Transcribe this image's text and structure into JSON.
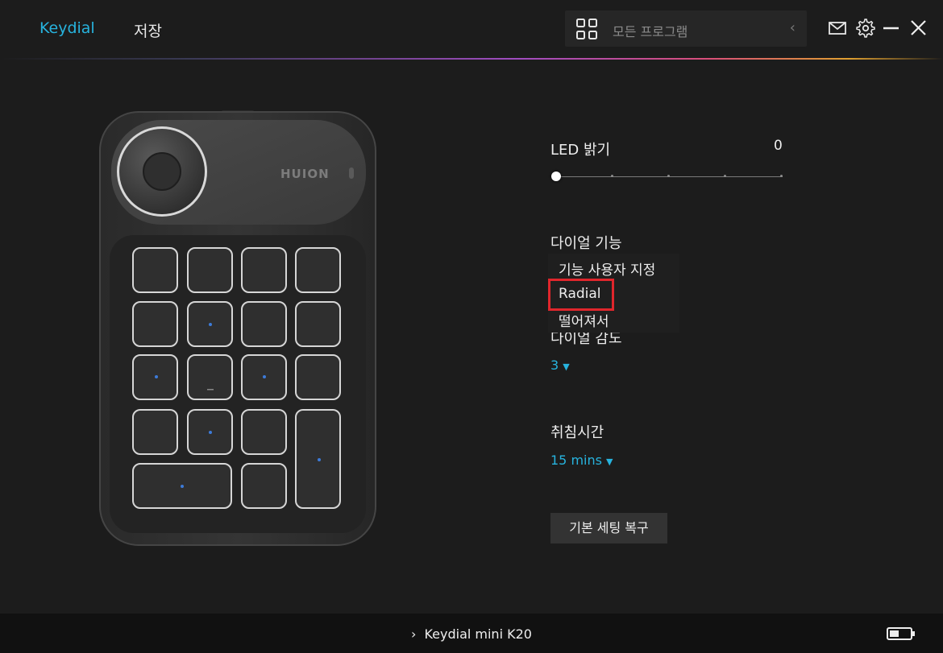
{
  "header": {
    "tabs": [
      {
        "label": "Keydial"
      },
      {
        "label": "저장"
      }
    ],
    "program_selector": {
      "label": "모든 프로그램",
      "icon": "grid-icon",
      "arrow_icon": "chevron-left-icon"
    },
    "icons": [
      "mail-icon",
      "gear-icon",
      "minimize-icon",
      "close-icon"
    ],
    "accent_color": "#27b3de"
  },
  "device": {
    "brand": "HUION"
  },
  "settings": {
    "led": {
      "label": "LED 밝기",
      "value": "0"
    },
    "dial_function": {
      "label": "다이얼 기능",
      "options": [
        "기능 사용자 지정",
        "Radial",
        "떨어져서"
      ],
      "highlighted": "Radial"
    },
    "dial_sensitivity": {
      "label": "다이얼 감도",
      "value": "3"
    },
    "sleep_time": {
      "label": "취침시간",
      "value": "15 mins"
    },
    "reset_button": "기본 세팅 복구"
  },
  "footer": {
    "device_name": "Keydial mini K20",
    "chevron_icon": "chevron-right-icon",
    "battery_icon": "battery-icon"
  }
}
